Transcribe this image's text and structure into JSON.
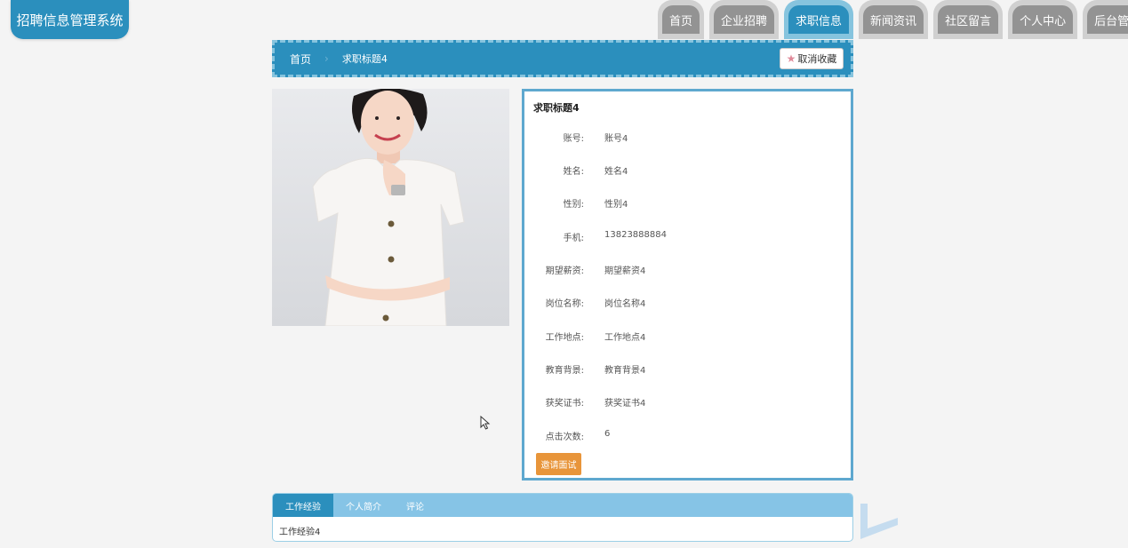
{
  "app": {
    "title": "招聘信息管理系统"
  },
  "nav": {
    "tabs": [
      {
        "label": "首页",
        "active": false
      },
      {
        "label": "企业招聘",
        "active": false
      },
      {
        "label": "求职信息",
        "active": true
      },
      {
        "label": "新闻资讯",
        "active": false
      },
      {
        "label": "社区留言",
        "active": false
      },
      {
        "label": "个人中心",
        "active": false
      },
      {
        "label": "后台管理",
        "active": false
      }
    ]
  },
  "breadcrumb": {
    "home": "首页",
    "current": "求职标题4",
    "favorite_button": "取消收藏",
    "favorite_icon": "star-icon"
  },
  "detail": {
    "title": "求职标题4",
    "fields": [
      {
        "label": "账号:",
        "value": "账号4"
      },
      {
        "label": "姓名:",
        "value": "姓名4"
      },
      {
        "label": "性别:",
        "value": "性别4"
      },
      {
        "label": "手机:",
        "value": "13823888884"
      },
      {
        "label": "期望薪资:",
        "value": "期望薪资4"
      },
      {
        "label": "岗位名称:",
        "value": "岗位名称4"
      },
      {
        "label": "工作地点:",
        "value": "工作地点4"
      },
      {
        "label": "教育背景:",
        "value": "教育背景4"
      },
      {
        "label": "获奖证书:",
        "value": "获奖证书4"
      },
      {
        "label": "点击次数:",
        "value": "6"
      }
    ],
    "invite_button": "邀请面试"
  },
  "bottom_tabs": {
    "tabs": [
      {
        "label": "工作经验",
        "active": true
      },
      {
        "label": "个人简介",
        "active": false
      },
      {
        "label": "评论",
        "active": false
      }
    ],
    "content": "工作经验4"
  },
  "colors": {
    "primary": "#2b8fbd",
    "light": "#86c4de",
    "accent": "#e8953a"
  }
}
